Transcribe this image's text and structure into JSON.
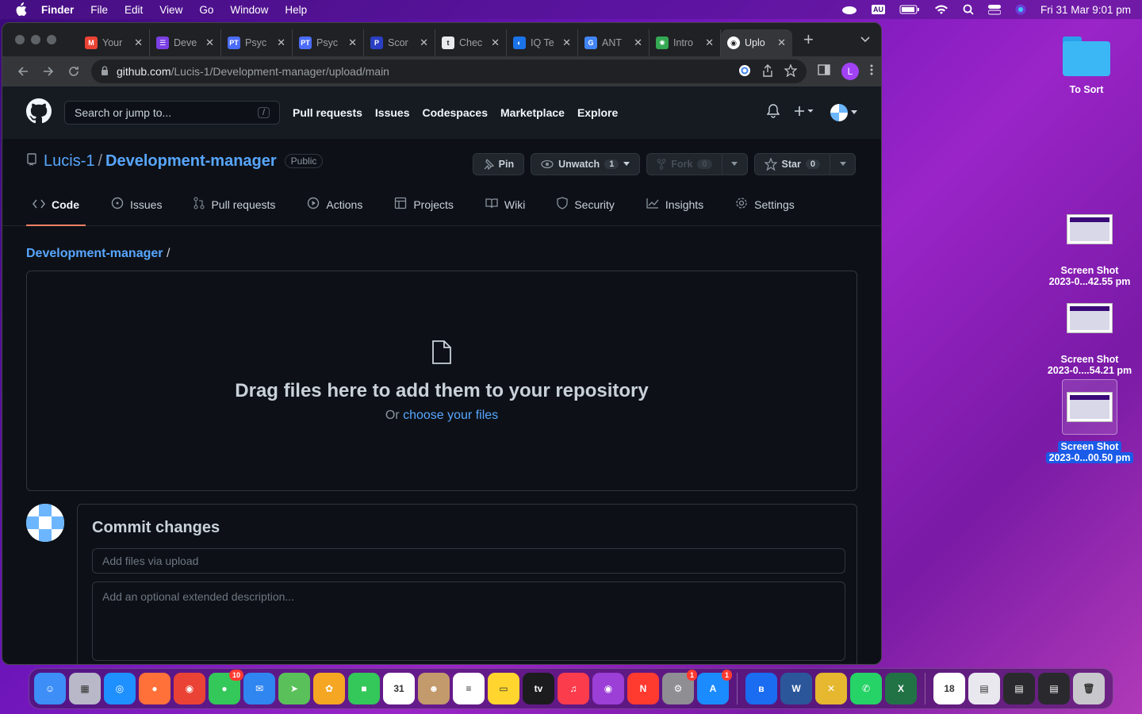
{
  "menubar": {
    "app": "Finder",
    "items": [
      "File",
      "Edit",
      "View",
      "Go",
      "Window",
      "Help"
    ],
    "input_source": "AU",
    "clock": "Fri 31 Mar  9:01 pm"
  },
  "browser": {
    "tabs": [
      {
        "title": "Your",
        "fav_color": "#ea4335",
        "fav_glyph": "M"
      },
      {
        "title": "Deve",
        "fav_color": "#7b3fe4",
        "fav_glyph": "☰"
      },
      {
        "title": "Psyc",
        "fav_color": "#4a6cf7",
        "fav_glyph": "PT"
      },
      {
        "title": "Psyc",
        "fav_color": "#4a6cf7",
        "fav_glyph": "PT"
      },
      {
        "title": "Scor",
        "fav_color": "#2b3fc4",
        "fav_glyph": "P"
      },
      {
        "title": "Chec",
        "fav_color": "#e8eaed",
        "fav_glyph": "t"
      },
      {
        "title": "IQ Te",
        "fav_color": "#1a73e8",
        "fav_glyph": "◐"
      },
      {
        "title": "ANT",
        "fav_color": "#4285f4",
        "fav_glyph": "G"
      },
      {
        "title": "Intro",
        "fav_color": "#34a853",
        "fav_glyph": "✺"
      },
      {
        "title": "Uplo",
        "fav_color": "#202124",
        "fav_glyph": "◉",
        "active": true
      }
    ],
    "url_host": "github.com",
    "url_path": "/Lucis-1/Development-manager/upload/main",
    "profile_initial": "L"
  },
  "github": {
    "search_placeholder": "Search or jump to...",
    "search_shortcut": "/",
    "nav": [
      "Pull requests",
      "Issues",
      "Codespaces",
      "Marketplace",
      "Explore"
    ],
    "repo_owner": "Lucis-1",
    "repo_name": "Development-manager",
    "visibility": "Public",
    "pin_label": "Pin",
    "unwatch_label": "Unwatch",
    "watch_count": "1",
    "fork_label": "Fork",
    "fork_count": "0",
    "star_label": "Star",
    "star_count": "0",
    "tabs": [
      {
        "label": "Code",
        "icon": "code-icon"
      },
      {
        "label": "Issues",
        "icon": "issue-icon"
      },
      {
        "label": "Pull requests",
        "icon": "pull-request-icon"
      },
      {
        "label": "Actions",
        "icon": "play-icon"
      },
      {
        "label": "Projects",
        "icon": "table-icon"
      },
      {
        "label": "Wiki",
        "icon": "book-icon"
      },
      {
        "label": "Security",
        "icon": "shield-icon"
      },
      {
        "label": "Insights",
        "icon": "graph-icon"
      },
      {
        "label": "Settings",
        "icon": "gear-icon"
      }
    ],
    "breadcrumb_repo": "Development-manager",
    "breadcrumb_sep": "/",
    "dropzone_title": "Drag files here to add them to your repository",
    "dropzone_or": "Or",
    "dropzone_link": "choose your files",
    "commit_title": "Commit changes",
    "commit_placeholder": "Add files via upload",
    "description_placeholder": "Add an optional extended description..."
  },
  "desktop": {
    "folder_label": "To Sort",
    "shots": [
      {
        "line1": "Screen Shot",
        "line2": "2023-0...42.55 pm"
      },
      {
        "line1": "Screen Shot",
        "line2": "2023-0....54.21 pm"
      },
      {
        "line1": "Screen Shot",
        "line2": "2023-0...00.50 pm",
        "selected": true
      }
    ]
  },
  "dock": {
    "apps": [
      {
        "name": "Finder",
        "color": "#3d8ef7",
        "glyph": "☺"
      },
      {
        "name": "Launchpad",
        "color": "#b8b8c8",
        "glyph": "▦"
      },
      {
        "name": "Safari",
        "color": "#1e90ff",
        "glyph": "◎"
      },
      {
        "name": "Firefox",
        "color": "#ff7139",
        "glyph": "●"
      },
      {
        "name": "Chrome",
        "color": "#ea4335",
        "glyph": "◉"
      },
      {
        "name": "Messages",
        "color": "#34c759",
        "glyph": "●",
        "badge": "10"
      },
      {
        "name": "Mail",
        "color": "#2f86f0",
        "glyph": "✉"
      },
      {
        "name": "Maps",
        "color": "#5ac15a",
        "glyph": "➤"
      },
      {
        "name": "Photos",
        "color": "#f5a623",
        "glyph": "✿"
      },
      {
        "name": "FaceTime",
        "color": "#34c759",
        "glyph": "■"
      },
      {
        "name": "Calendar",
        "color": "#ffffff",
        "glyph": "31"
      },
      {
        "name": "Contacts",
        "color": "#c39a6b",
        "glyph": "☻"
      },
      {
        "name": "Reminders",
        "color": "#ffffff",
        "glyph": "≡"
      },
      {
        "name": "Notes",
        "color": "#ffd52e",
        "glyph": "▭"
      },
      {
        "name": "TV",
        "color": "#1c1c1e",
        "glyph": "tv"
      },
      {
        "name": "Music",
        "color": "#fa3c4c",
        "glyph": "♫"
      },
      {
        "name": "Podcasts",
        "color": "#9b3fd6",
        "glyph": "◉"
      },
      {
        "name": "News",
        "color": "#ff3b30",
        "glyph": "N"
      },
      {
        "name": "System Preferences",
        "color": "#8e8e93",
        "glyph": "⚙",
        "badge": "1"
      },
      {
        "name": "App Store",
        "color": "#1a8cff",
        "glyph": "A",
        "badge": "1"
      },
      {
        "name": "Bluetooth",
        "color": "#1a6cf0",
        "glyph": "ʙ"
      },
      {
        "name": "Word",
        "color": "#2b579a",
        "glyph": "W"
      },
      {
        "name": "Utility",
        "color": "#e6b830",
        "glyph": "✕"
      },
      {
        "name": "WhatsApp",
        "color": "#25d366",
        "glyph": "✆"
      },
      {
        "name": "Excel",
        "color": "#217346",
        "glyph": "X"
      },
      {
        "name": "Calendar Doc",
        "color": "#ffffff",
        "glyph": "18"
      },
      {
        "name": "Stack 1",
        "color": "#e8e8ee",
        "glyph": "▤"
      },
      {
        "name": "Stack 2",
        "color": "#2a2a2e",
        "glyph": "▤"
      },
      {
        "name": "Stack 3",
        "color": "#2a2a2e",
        "glyph": "▤"
      },
      {
        "name": "Trash",
        "color": "#c8c8cc",
        "glyph": "🗑"
      }
    ]
  }
}
